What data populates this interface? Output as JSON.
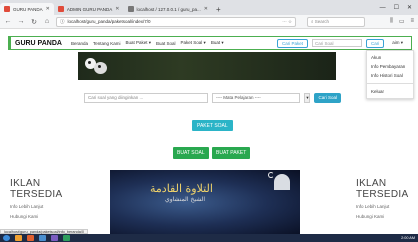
{
  "browser": {
    "tabs": [
      {
        "label": "GURU PANDA",
        "active": true
      },
      {
        "label": "ADMIN GURU PANDA",
        "active": false
      },
      {
        "label": "localhost / 127.0.0.1 / guru_pa...",
        "active": false
      }
    ],
    "new_tab": "+",
    "url": "localhost/guru_panda/paketsoal/index/7/0",
    "search_placeholder": "Search",
    "win_controls": [
      "—",
      "☐",
      "✕"
    ]
  },
  "site": {
    "brand": "GURU PANDA",
    "menu": [
      "Beranda",
      "Tentang Kami",
      "Buat Paket ▾",
      "Buat Soal",
      "Paket Soal ▾",
      "Buat ▾"
    ],
    "cari_paket": "Cari Paket",
    "search_placeholder": "Cari Soal",
    "cari_button": "Cari",
    "user": "aim ▾",
    "dropdown": [
      "Akun",
      "Info Pembayaran",
      "Info Histori Soal",
      "Keluar"
    ]
  },
  "search": {
    "placeholder": "Cari soal yang diinginkan ...",
    "select": "---- Mata Pelajaran ----",
    "button": "Cari Soal"
  },
  "buttons": {
    "paket_soal": "PAKET SOAL",
    "buat_soal": "BUAT SOAL",
    "buat_paket": "BUAT PAKET"
  },
  "ads": {
    "left": {
      "line1": "IKLAN",
      "line2": "TERSEDIA",
      "info1": "Info Lebih Lanjut",
      "info2": "Hubungi Kami"
    },
    "right": {
      "line1": "IKLAN",
      "line2": "TERSEDIA",
      "info1": "Info Lebih Lanjut",
      "info2": "Hubungi Kami"
    }
  },
  "video": {
    "title": "التلاوة القادمة",
    "subtitle": "الشيخ المنشاوي"
  },
  "status_bar": "localhost/guru_panda/paketsoal/info_beranda/0",
  "taskbar": {
    "clock": "2:00 AM"
  }
}
